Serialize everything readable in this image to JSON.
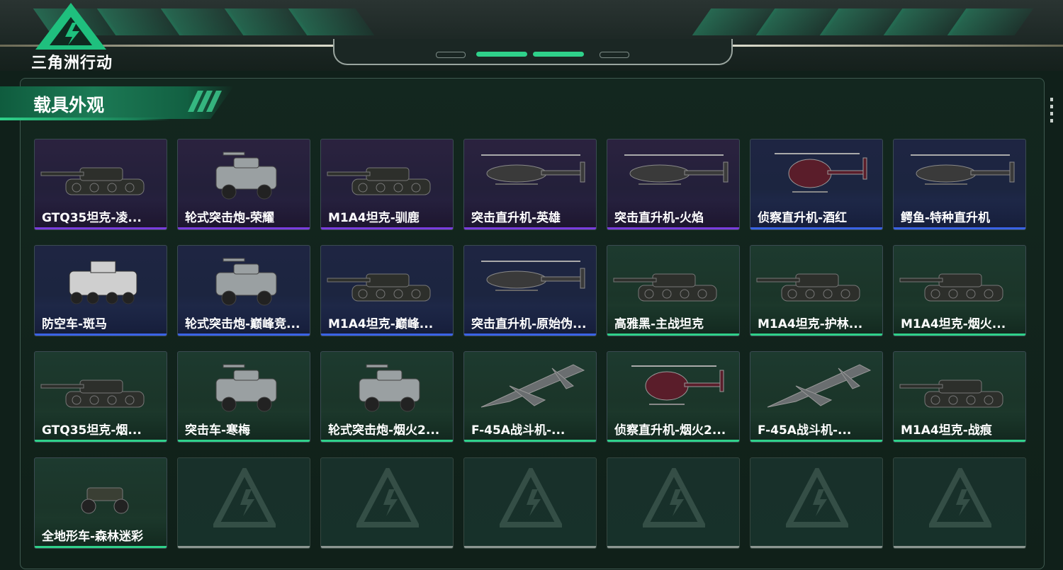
{
  "game": {
    "logo_text": "三角洲行动"
  },
  "panel": {
    "title": "载具外观"
  },
  "colors": {
    "legendary": "#7a3dde",
    "epic": "#3a63e6",
    "rare": "#2fd18a",
    "empty": "#8c9691"
  },
  "skins": [
    {
      "name": "GTQ35坦克-凌...",
      "rarity": "purple",
      "icon": "tank"
    },
    {
      "name": "轮式突击炮-荣耀",
      "rarity": "purple",
      "icon": "armored-car"
    },
    {
      "name": "M1A4坦克-驯鹿",
      "rarity": "purple",
      "icon": "tank"
    },
    {
      "name": "突击直升机-英雄",
      "rarity": "purple",
      "icon": "attack-heli"
    },
    {
      "name": "突击直升机-火焰",
      "rarity": "purple",
      "icon": "attack-heli"
    },
    {
      "name": "侦察直升机-酒红",
      "rarity": "blue",
      "icon": "scout-heli"
    },
    {
      "name": "鳄鱼-特种直升机",
      "rarity": "blue",
      "icon": "attack-heli"
    },
    {
      "name": "防空车-斑马",
      "rarity": "blue",
      "icon": "aa-vehicle"
    },
    {
      "name": "轮式突击炮-巅峰竞...",
      "rarity": "blue",
      "icon": "armored-car"
    },
    {
      "name": "M1A4坦克-巅峰...",
      "rarity": "blue",
      "icon": "tank"
    },
    {
      "name": "突击直升机-原始伪...",
      "rarity": "blue",
      "icon": "attack-heli"
    },
    {
      "name": "高雅黑-主战坦克",
      "rarity": "green",
      "icon": "tank"
    },
    {
      "name": "M1A4坦克-护林...",
      "rarity": "green",
      "icon": "tank"
    },
    {
      "name": "M1A4坦克-烟火...",
      "rarity": "green",
      "icon": "tank"
    },
    {
      "name": "GTQ35坦克-烟...",
      "rarity": "green",
      "icon": "tank"
    },
    {
      "name": "突击车-寒梅",
      "rarity": "green",
      "icon": "armored-car"
    },
    {
      "name": "轮式突击炮-烟火2...",
      "rarity": "green",
      "icon": "armored-car"
    },
    {
      "name": "F-45A战斗机-...",
      "rarity": "green",
      "icon": "jet"
    },
    {
      "name": "侦察直升机-烟火2...",
      "rarity": "green",
      "icon": "scout-heli"
    },
    {
      "name": "F-45A战斗机-...",
      "rarity": "green",
      "icon": "jet"
    },
    {
      "name": "M1A4坦克-战痕",
      "rarity": "green",
      "icon": "tank"
    },
    {
      "name": "全地形车-森林迷彩",
      "rarity": "green",
      "icon": "atv"
    },
    {
      "name": "",
      "rarity": "empty",
      "icon": "placeholder"
    },
    {
      "name": "",
      "rarity": "empty",
      "icon": "placeholder"
    },
    {
      "name": "",
      "rarity": "empty",
      "icon": "placeholder"
    },
    {
      "name": "",
      "rarity": "empty",
      "icon": "placeholder"
    },
    {
      "name": "",
      "rarity": "empty",
      "icon": "placeholder"
    },
    {
      "name": "",
      "rarity": "empty",
      "icon": "placeholder"
    }
  ]
}
